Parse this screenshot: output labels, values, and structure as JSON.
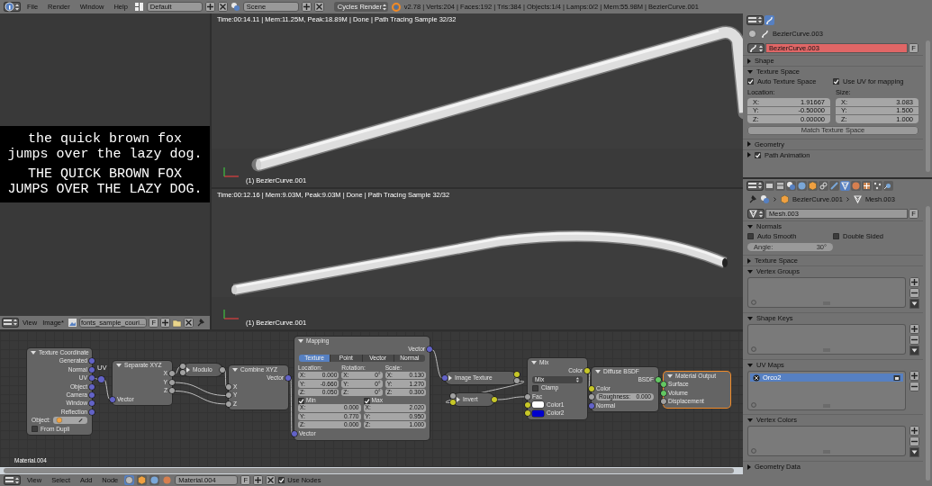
{
  "topbar": {
    "menus": [
      "File",
      "Render",
      "Window",
      "Help"
    ],
    "layout": "Default",
    "scene": "Scene",
    "engine": "Cycles Render",
    "stats": "v2.78 | Verts:204 | Faces:192 | Tris:384 | Objects:1/4 | Lamps:0/2 | Mem:55.98M | BezierCurve.001"
  },
  "image_editor": {
    "lines": [
      "the quick brown fox",
      "jumps over the lazy dog.",
      "THE QUICK BROWN FOX",
      "JUMPS OVER THE LAZY DOG."
    ],
    "menus": [
      "View",
      "Image*"
    ],
    "image_name": "fonts_sample_couri...",
    "fake_user": "F"
  },
  "viewports": [
    {
      "info": "Time:00:14.11 | Mem:11.25M, Peak:18.89M | Done | Path Tracing Sample 32/32",
      "object": "(1) BezierCurve.001"
    },
    {
      "info": "Time:00:12.16 | Mem:9.03M, Peak:9.03M | Done | Path Tracing Sample 32/32",
      "object": "(1) BezierCurve.001"
    }
  ],
  "node_editor": {
    "material_label": "Material.004",
    "nodes": [
      {
        "kind": "node",
        "title": "Texture Coordinate",
        "selected": false,
        "rows": [
          {
            "kind": "output",
            "label": "Generated",
            "socket": {
              "kind": "vector"
            }
          },
          {
            "kind": "output",
            "label": "Normal",
            "socket": {
              "kind": "vector"
            }
          },
          {
            "kind": "output",
            "label": "UV",
            "socket": {
              "kind": "vector"
            }
          },
          {
            "kind": "output",
            "label": "Object",
            "socket": {
              "kind": "vector"
            }
          },
          {
            "kind": "output",
            "label": "Camera",
            "socket": {
              "kind": "vector"
            }
          },
          {
            "kind": "output",
            "label": "Window",
            "socket": {
              "kind": "vector"
            }
          },
          {
            "kind": "output",
            "label": "Reflection",
            "socket": {
              "kind": "vector"
            }
          },
          {
            "kind": "object_field",
            "label": "Object:"
          },
          {
            "kind": "checkbox",
            "label": "From Dupli",
            "checked": false
          }
        ]
      },
      {
        "kind": "reroute",
        "label": "UV",
        "socket": {
          "kind": "vector"
        }
      },
      {
        "kind": "node",
        "title": "Separate XYZ",
        "selected": false,
        "rows": [
          {
            "kind": "output",
            "label": "X",
            "socket": {
              "kind": "value"
            }
          },
          {
            "kind": "output",
            "label": "Y",
            "socket": {
              "kind": "value"
            }
          },
          {
            "kind": "output",
            "label": "Z",
            "socket": {
              "kind": "value"
            }
          },
          {
            "kind": "input",
            "label": "Vector",
            "socket": {
              "kind": "vector"
            }
          }
        ]
      },
      {
        "kind": "collapsed",
        "title": "Modulo",
        "selected": false,
        "inputs": [
          {
            "kind": "value"
          },
          {
            "kind": "value"
          }
        ],
        "outputs": [
          {
            "kind": "value"
          }
        ]
      },
      {
        "kind": "node",
        "title": "Combine XYZ",
        "selected": false,
        "rows": [
          {
            "kind": "output",
            "label": "Vector",
            "socket": {
              "kind": "vector"
            }
          },
          {
            "kind": "input",
            "label": "X",
            "socket": {
              "kind": "value"
            }
          },
          {
            "kind": "input",
            "label": "Y",
            "socket": {
              "kind": "value"
            }
          },
          {
            "kind": "input",
            "label": "Z",
            "socket": {
              "kind": "value"
            }
          }
        ]
      },
      {
        "kind": "node",
        "title": "Mapping",
        "selected": false,
        "rows": [
          {
            "kind": "output",
            "label": "Vector",
            "socket": {
              "kind": "vector"
            }
          },
          {
            "kind": "tabs",
            "items": [
              {
                "label": "Texture",
                "selected": true
              },
              {
                "label": "Point",
                "selected": false
              },
              {
                "label": "Vector",
                "selected": false
              },
              {
                "label": "Normal",
                "selected": false
              }
            ]
          },
          {
            "kind": "vector_columns",
            "columns": [
              {
                "label": "Location:",
                "values": [
                  {
                    "axis": "X:",
                    "value": "0.000"
                  },
                  {
                    "axis": "Y:",
                    "value": "-0.660"
                  },
                  {
                    "axis": "Z:",
                    "value": "0.050"
                  }
                ]
              },
              {
                "label": "Rotation:",
                "values": [
                  {
                    "axis": "X:",
                    "value": "0°"
                  },
                  {
                    "axis": "Y:",
                    "value": "0°"
                  },
                  {
                    "axis": "Z:",
                    "value": "0°"
                  }
                ]
              },
              {
                "label": "Scale:",
                "values": [
                  {
                    "axis": "X:",
                    "value": "0.130"
                  },
                  {
                    "axis": "Y:",
                    "value": "1.270"
                  },
                  {
                    "axis": "Z:",
                    "value": "0.300"
                  }
                ]
              }
            ]
          },
          {
            "kind": "vector_columns",
            "columns": [
              {
                "label": "Min",
                "checked": true,
                "values": [
                  {
                    "axis": "X:",
                    "value": "0.000"
                  },
                  {
                    "axis": "Y:",
                    "value": "0.770"
                  },
                  {
                    "axis": "Z:",
                    "value": "0.000"
                  }
                ]
              },
              {
                "label": "Max",
                "checked": true,
                "values": [
                  {
                    "axis": "X:",
                    "value": "2.020"
                  },
                  {
                    "axis": "Y:",
                    "value": "0.950"
                  },
                  {
                    "axis": "Z:",
                    "value": "1.000"
                  }
                ]
              }
            ]
          },
          {
            "kind": "input",
            "label": "Vector",
            "socket": {
              "kind": "vector"
            }
          }
        ]
      },
      {
        "kind": "collapsed",
        "title": "Image Texture",
        "selected": false,
        "inputs": [
          {
            "kind": "vector"
          }
        ],
        "outputs": [
          {
            "kind": "color"
          },
          {
            "kind": "value"
          }
        ]
      },
      {
        "kind": "collapsed",
        "title": "Invert",
        "selected": false,
        "inputs": [
          {
            "kind": "value"
          },
          {
            "kind": "color"
          }
        ],
        "outputs": [
          {
            "kind": "color"
          }
        ]
      },
      {
        "kind": "node",
        "title": "Mix",
        "selected": false,
        "rows": [
          {
            "kind": "output",
            "label": "Color",
            "socket": {
              "kind": "color"
            }
          },
          {
            "kind": "dropdown",
            "value": "Mix"
          },
          {
            "kind": "checkbox",
            "label": "Clamp",
            "checked": false
          },
          {
            "kind": "input",
            "label": "Fac",
            "socket": {
              "kind": "value"
            }
          },
          {
            "kind": "color_input",
            "label": "Color1",
            "socket": {
              "kind": "color"
            },
            "color": "#ffffff"
          },
          {
            "kind": "color_input",
            "label": "Color2",
            "socket": {
              "kind": "color"
            },
            "color": "#0000cc"
          }
        ]
      },
      {
        "kind": "node",
        "title": "Diffuse BSDF",
        "selected": false,
        "rows": [
          {
            "kind": "output",
            "label": "BSDF",
            "socket": {
              "kind": "shader"
            }
          },
          {
            "kind": "input",
            "label": "Color",
            "socket": {
              "kind": "color"
            }
          },
          {
            "kind": "slider_input",
            "label": "Roughness:",
            "value": "0.000",
            "socket": {
              "kind": "value"
            }
          },
          {
            "kind": "input",
            "label": "Normal",
            "socket": {
              "kind": "vector"
            }
          }
        ]
      },
      {
        "kind": "node",
        "title": "Material Output",
        "selected": true,
        "rows": [
          {
            "kind": "input",
            "label": "Surface",
            "socket": {
              "kind": "shader"
            }
          },
          {
            "kind": "input",
            "label": "Volume",
            "socket": {
              "kind": "shader"
            }
          },
          {
            "kind": "input",
            "label": "Displacement",
            "socket": {
              "kind": "value"
            }
          }
        ]
      }
    ],
    "header": {
      "menus": [
        "View",
        "Select",
        "Add",
        "Node"
      ],
      "material": "Material.004",
      "fake_user": "F",
      "use_nodes": {
        "label": "Use Nodes",
        "checked": true
      }
    }
  },
  "properties_top": {
    "tabs": [
      {
        "kind": "curve",
        "selected": true
      }
    ],
    "breadcrumb": [
      {
        "kind": "scene"
      },
      {
        "kind": "curve",
        "label": "BezierCurve.003"
      }
    ],
    "datablock": {
      "kind": "curve",
      "name": "BezierCurve.003",
      "fake_user": "F",
      "warning": true
    },
    "panels": [
      {
        "title": "Shape",
        "expanded": false
      },
      {
        "title": "Texture Space",
        "expanded": true,
        "rows": [
          {
            "kind": "checkboxes",
            "items": [
              {
                "label": "Auto Texture Space",
                "checked": true
              },
              {
                "label": "Use UV for mapping",
                "checked": true
              }
            ]
          },
          {
            "kind": "vectors",
            "columns": [
              {
                "label": "Location:",
                "values": [
                  {
                    "axis": "X:",
                    "value": "1.91667"
                  },
                  {
                    "axis": "Y:",
                    "value": "-0.50000"
                  },
                  {
                    "axis": "Z:",
                    "value": "0.00000"
                  }
                ]
              },
              {
                "label": "Size:",
                "values": [
                  {
                    "axis": "X:",
                    "value": "3.083"
                  },
                  {
                    "axis": "Y:",
                    "value": "1.500"
                  },
                  {
                    "axis": "Z:",
                    "value": "1.000"
                  }
                ]
              }
            ]
          },
          {
            "kind": "button",
            "label": "Match Texture Space",
            "disabled": true
          }
        ]
      },
      {
        "title": "Geometry",
        "expanded": false
      },
      {
        "title": "Path Animation",
        "expanded": false,
        "checked": true
      }
    ]
  },
  "properties_bottom": {
    "tabs": [
      {
        "kind": "render",
        "selected": false
      },
      {
        "kind": "layers",
        "selected": false
      },
      {
        "kind": "scene",
        "selected": false
      },
      {
        "kind": "world",
        "selected": false
      },
      {
        "kind": "object",
        "selected": false
      },
      {
        "kind": "constraints",
        "selected": false
      },
      {
        "kind": "modifiers",
        "selected": false
      },
      {
        "kind": "mesh",
        "selected": true
      },
      {
        "kind": "material",
        "selected": false
      },
      {
        "kind": "texture",
        "selected": false
      },
      {
        "kind": "particles",
        "selected": false
      },
      {
        "kind": "physics",
        "selected": false
      }
    ],
    "breadcrumb": [
      {
        "kind": "pin"
      },
      {
        "kind": "scene"
      },
      {
        "kind": "object",
        "label": "BezierCurve.001",
        "separator": true
      },
      {
        "kind": "mesh",
        "label": "Mesh.003",
        "separator": true
      }
    ],
    "datablock": {
      "kind": "mesh",
      "name": "Mesh.003",
      "fake_user": "F",
      "warning": false
    },
    "panels": [
      {
        "title": "Normals",
        "expanded": true,
        "rows": [
          {
            "kind": "checkboxes",
            "items": [
              {
                "label": "Auto Smooth",
                "checked": false
              },
              {
                "label": "Double Sided",
                "checked": false
              }
            ]
          },
          {
            "kind": "slider",
            "label": "Angle:",
            "value": "30°",
            "disabled": true
          }
        ]
      },
      {
        "title": "Texture Space",
        "expanded": false
      },
      {
        "title": "Vertex Groups",
        "expanded": true,
        "rows": [
          {
            "kind": "list"
          }
        ]
      },
      {
        "title": "Shape Keys",
        "expanded": true,
        "rows": [
          {
            "kind": "list"
          }
        ]
      },
      {
        "title": "UV Maps",
        "expanded": true,
        "rows": [
          {
            "kind": "list",
            "items": [
              {
                "label": "Orco2",
                "selected": true
              }
            ]
          }
        ]
      },
      {
        "title": "Vertex Colors",
        "expanded": true,
        "rows": [
          {
            "kind": "list"
          }
        ]
      },
      {
        "title": "Geometry Data",
        "expanded": false
      }
    ]
  }
}
